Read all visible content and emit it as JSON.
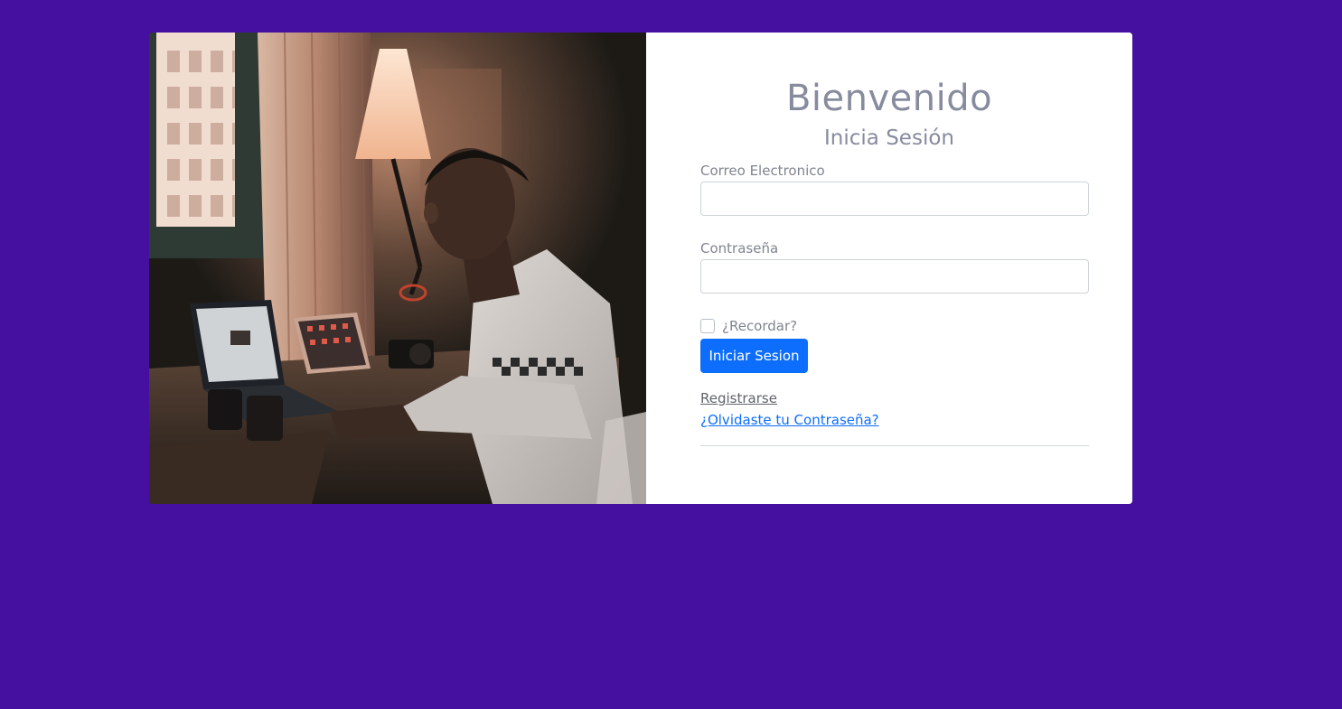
{
  "login": {
    "title": "Bienvenido",
    "subtitle": "Inicia Sesión",
    "email_label": "Correo Electronico",
    "email_value": "",
    "password_label": "Contraseña",
    "password_value": "",
    "remember_label": "¿Recordar?",
    "remember_checked": false,
    "submit_label": "Iniciar Sesion",
    "register_link": "Registrarse",
    "forgot_link": "¿Olvidaste tu Contraseña?"
  },
  "colors": {
    "background": "#450fa0",
    "primary": "#0d6efd",
    "muted_text": "#878b9e"
  }
}
